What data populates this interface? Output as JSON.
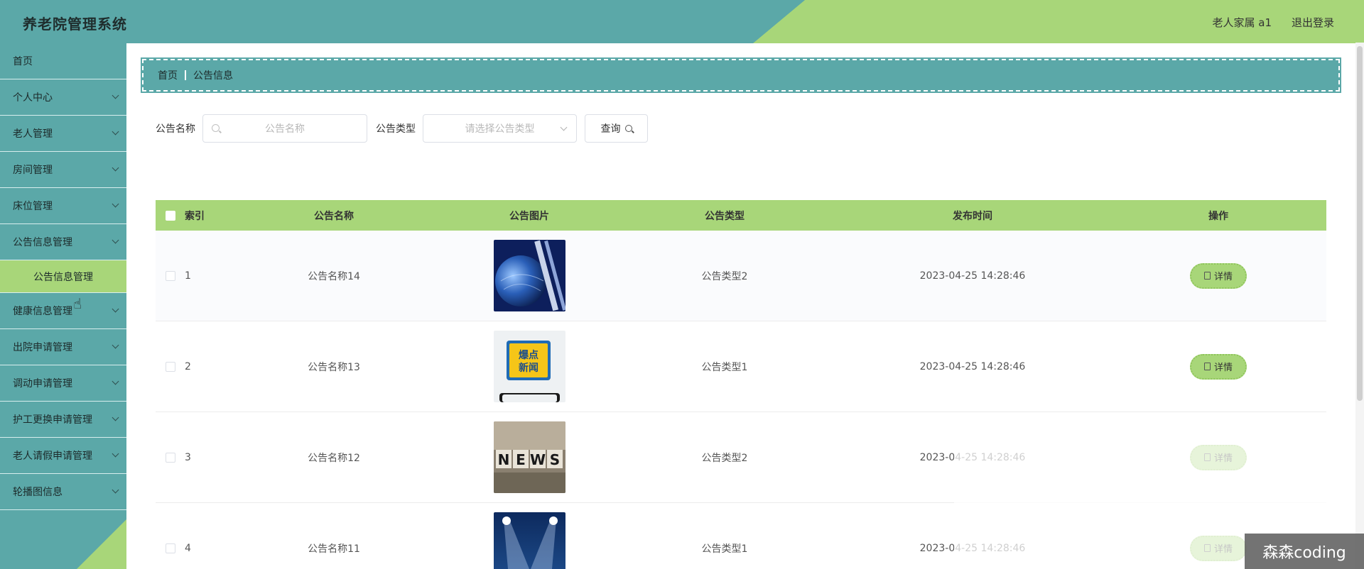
{
  "header": {
    "app_title": "养老院管理系统",
    "user_label": "老人家属 a1",
    "logout_label": "退出登录"
  },
  "sidebar": {
    "items": [
      {
        "label": "首页"
      },
      {
        "label": "个人中心"
      },
      {
        "label": "老人管理"
      },
      {
        "label": "房间管理"
      },
      {
        "label": "床位管理"
      },
      {
        "label": "公告信息管理"
      },
      {
        "label": "健康信息管理"
      },
      {
        "label": "出院申请管理"
      },
      {
        "label": "调动申请管理"
      },
      {
        "label": "护工更换申请管理"
      },
      {
        "label": "老人请假申请管理"
      },
      {
        "label": "轮播图信息"
      }
    ],
    "active_sub": "公告信息管理"
  },
  "breadcrumb": {
    "home": "首页",
    "current": "公告信息"
  },
  "search": {
    "name_label": "公告名称",
    "name_placeholder": "公告名称",
    "type_label": "公告类型",
    "type_placeholder": "请选择公告类型",
    "query_label": "查询"
  },
  "table": {
    "headers": {
      "index": "索引",
      "name": "公告名称",
      "image": "公告图片",
      "type": "公告类型",
      "time": "发布时间",
      "action": "操作"
    },
    "rows": [
      {
        "index": "1",
        "name": "公告名称14",
        "image": "globe-news-thumbnail",
        "type": "公告类型2",
        "time": "2023-04-25 14:28:46",
        "action": "详情"
      },
      {
        "index": "2",
        "name": "公告名称13",
        "image": "breaking-news-phone-thumbnail",
        "image_text": "爆点新闻",
        "type": "公告类型1",
        "time": "2023-04-25 14:28:46",
        "action": "详情"
      },
      {
        "index": "3",
        "name": "公告名称12",
        "image": "news-blocks-thumbnail",
        "image_text": "NEWS",
        "type": "公告类型2",
        "time": "2023-04-25 14:28:46",
        "action": "详情"
      },
      {
        "index": "4",
        "name": "公告名称11",
        "image": "spotlight-stage-thumbnail",
        "type": "公告类型1",
        "time": "2023-04-25 14:28:46",
        "action": "详情"
      }
    ]
  },
  "watermark": "森森coding",
  "colors": {
    "teal": "#5ba8a8",
    "green": "#a8d679"
  }
}
